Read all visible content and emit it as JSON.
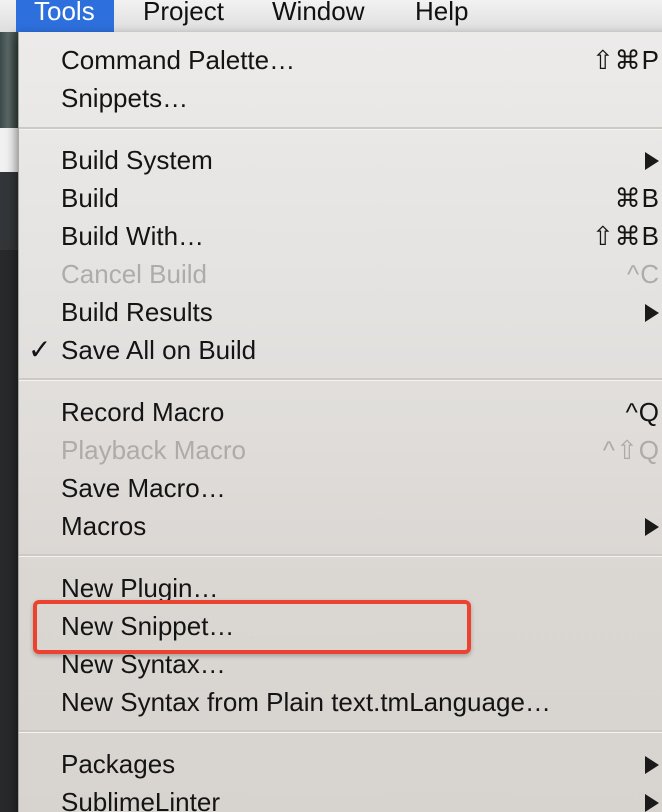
{
  "menubar": {
    "items": [
      {
        "label": "Tools",
        "active": true
      },
      {
        "label": "Project",
        "active": false
      },
      {
        "label": "Window",
        "active": false
      },
      {
        "label": "Help",
        "active": false
      }
    ]
  },
  "menu": {
    "items": [
      {
        "label": "Command Palette…",
        "shortcut": "⇧⌘P"
      },
      {
        "label": "Snippets…",
        "shortcut": ""
      },
      {
        "label": "Build System",
        "submenu": true
      },
      {
        "label": "Build",
        "shortcut": "⌘B"
      },
      {
        "label": "Build With…",
        "shortcut": "⇧⌘B"
      },
      {
        "label": "Cancel Build",
        "shortcut": "^C",
        "disabled": true
      },
      {
        "label": "Build Results",
        "submenu": true
      },
      {
        "label": "Save All on Build",
        "checked": true,
        "check_mark": "✓"
      },
      {
        "label": "Record Macro",
        "shortcut": "^Q"
      },
      {
        "label": "Playback Macro",
        "shortcut": "^⇧Q",
        "disabled": true
      },
      {
        "label": "Save Macro…",
        "shortcut": ""
      },
      {
        "label": "Macros",
        "submenu": true
      },
      {
        "label": "New Plugin…",
        "shortcut": ""
      },
      {
        "label": "New Snippet…",
        "shortcut": "",
        "highlighted": true
      },
      {
        "label": "New Syntax…",
        "shortcut": ""
      },
      {
        "label": "New Syntax from Plain text.tmLanguage…",
        "shortcut": ""
      },
      {
        "label": "Packages",
        "submenu": true
      },
      {
        "label": "SublimeLinter",
        "submenu": true
      }
    ]
  },
  "annotation": {
    "color": "#ec4331",
    "target": "New Snippet…"
  },
  "colors": {
    "menubar_active": "#2d6fdc",
    "disabled_text": "#aeaba8"
  }
}
